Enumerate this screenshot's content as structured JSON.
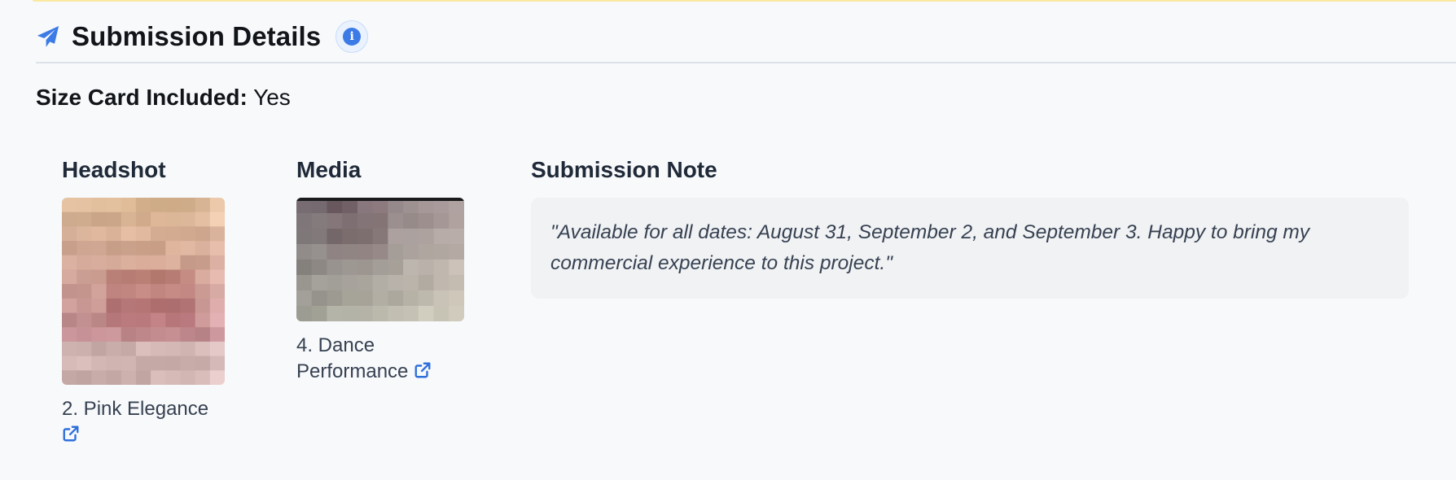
{
  "header": {
    "title": "Submission Details",
    "icon": "paper-plane-icon",
    "info_icon": "info-icon"
  },
  "size_card": {
    "label": "Size Card Included:",
    "value": "Yes"
  },
  "headshot": {
    "heading": "Headshot",
    "caption": "2. Pink Elegance",
    "link_icon": "external-link-icon"
  },
  "media": {
    "heading": "Media",
    "caption": "4. Dance Performance",
    "link_icon": "external-link-icon"
  },
  "note": {
    "heading": "Submission Note",
    "text": "\"Available for all dates: August 31, September 2, and September 3. Happy to bring my commercial experience to this project.\""
  },
  "colors": {
    "accent": "#3c7be6",
    "background": "#f7f9fb",
    "note_background": "#f0f2f4",
    "top_border": "#fbe9a0"
  }
}
